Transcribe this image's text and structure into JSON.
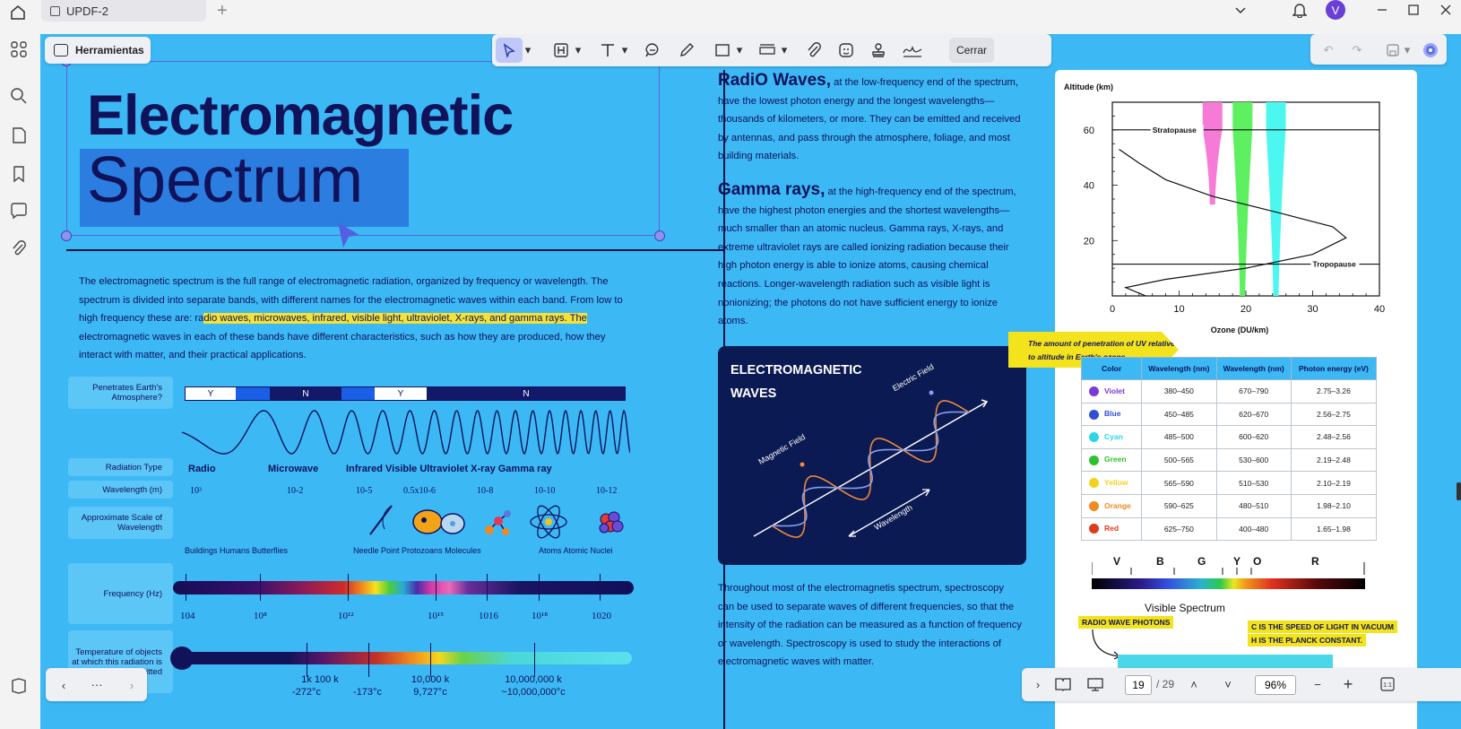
{
  "app": {
    "tab_title": "UPDF-2",
    "avatar_initial": "V"
  },
  "toolbar": {
    "tools_label": "Herramientas",
    "close_label": "Cerrar"
  },
  "left_page": {
    "title_line1": "Electromagnetic",
    "title_line2": "Spectrum",
    "intro_before": "The electromagnetic spectrum is the full range of electromagnetic radiation, organized by frequency or wavelength. The spectrum is divided into separate bands, with different names for the electromagnetic waves within each band. From low to high frequency these are: ra",
    "intro_highlight": "dio waves, microwaves, infrared, visible light, ultraviolet, X-rays, and gamma rays. The",
    "intro_after": " electromagnetic waves in each of these bands have different characteristics, such as how they are produced, how they interact with matter, and their practical applications.",
    "labels": {
      "atmosphere": "Penetrates Earth's Atmosphere?",
      "radiation_type": "Radiation Type",
      "wavelength": "Wavelength (m)",
      "scale": "Approximate Scale of Wavelength",
      "frequency": "Frequency (Hz)",
      "temperature": "Temperature of objects at which this radiation is the most intense emitted"
    },
    "atmosphere_segments": [
      "Y",
      "N",
      "Y",
      "N"
    ],
    "radiation_types": [
      "Radio",
      "Microwave",
      "Infrared Visible Ultraviolet X-ray Gamma ray"
    ],
    "wavelengths": [
      "10³",
      "10-2",
      "10-5",
      "0.5x10-6",
      "10-8",
      "10-10",
      "10-12"
    ],
    "scale_captions": [
      "Buildings Humans Butterflies",
      "Needle Point Protozoans Molecules",
      "Atoms Atomic Nuclei"
    ],
    "frequencies": [
      "104",
      "10⁸",
      "10¹²",
      "10¹⁵",
      "1016",
      "10¹⁸",
      "1020"
    ],
    "temperatures": [
      {
        "k": "1k 100 k",
        "c": "-272°c"
      },
      {
        "k": "",
        "c": "-173°c"
      },
      {
        "k": "10,000 k",
        "c": "9,727°c"
      },
      {
        "k": "10,000,000 k",
        "c": "~10,000,000°c"
      }
    ]
  },
  "mid_column": {
    "radio_lead": "RadiO Waves,",
    "radio_text": " at the low-frequency end of the spectrum, have the lowest photon energy and the longest wavelengths—thousands of kilometers, or more. They can be emitted and received by antennas, and pass through the atmosphere, foliage, and most building materials.",
    "gamma_lead": "Gamma rays,",
    "gamma_text": " at the high-frequency end of the spectrum, have the highest photon energies and the shortest wavelengths—much smaller than an atomic nucleus. Gamma rays, X-rays, and extreme ultraviolet rays are called ionizing radiation because their high photon energy is able to ionize atoms, causing chemical reactions. Longer-wavelength radiation such as visible light is nonionizing; the photons do not have sufficient energy to ionize atoms.",
    "card_title": "ELECTROMAGNETIC WAVES",
    "card_electric": "Electric Field",
    "card_magnetic": "Magnetic Field",
    "card_wavelength": "Wavelength",
    "spectro_text": "Throughout most of the electromagnetis spectrum, spectroscopy can be used to separate waves of different frequencies, so that the intensity of the radiation can be measured as a function of frequency or wavelength. Spectroscopy is used to study the interactions of electromagnetic waves with matter."
  },
  "right_column": {
    "callout": "The amount of penetration of UV relative to altitude in Earth's ozone",
    "table_headers": [
      "Color",
      "Wavelength (nm)",
      "Wavelength (nm)",
      "Photon energy (eV)"
    ],
    "table_rows": [
      {
        "color": "Violet",
        "hex": "#7a3ad8",
        "w1": "380–450",
        "w2": "670–790",
        "e": "2.75–3.26"
      },
      {
        "color": "Blue",
        "hex": "#2f4fd6",
        "w1": "450–485",
        "w2": "620–670",
        "e": "2.56–2.75"
      },
      {
        "color": "Cyan",
        "hex": "#2ad7e6",
        "w1": "485–500",
        "w2": "600–620",
        "e": "2.48–2.56"
      },
      {
        "color": "Green",
        "hex": "#2ec02e",
        "w1": "500–565",
        "w2": "530–600",
        "e": "2.19–2.48"
      },
      {
        "color": "Yellow",
        "hex": "#f2d41e",
        "w1": "565–590",
        "w2": "510–530",
        "e": "2.10–2.19"
      },
      {
        "color": "Orange",
        "hex": "#f08a1e",
        "w1": "590–625",
        "w2": "480–510",
        "e": "1.98–2.10"
      },
      {
        "color": "Red",
        "hex": "#e03a1e",
        "w1": "625–750",
        "w2": "400–480",
        "e": "1.65–1.98"
      }
    ],
    "spectrum_letters": [
      "V",
      "B",
      "G",
      "Y",
      "O",
      "R"
    ],
    "spectrum_caption": "Visible Spectrum",
    "note_radio": "RADIO WAVE PHOTONS",
    "note_c": "C IS THE SPEED OF LIGHT IN VACUUM",
    "note_h": "H IS THE PLANCK CONSTANT."
  },
  "chart_data": {
    "type": "line",
    "xlabel": "Ozone (DU/km)",
    "ylabel": "Altitude (km)",
    "xlim": [
      0,
      40
    ],
    "ylim": [
      0,
      70
    ],
    "xticks": [
      0,
      10,
      20,
      30,
      40
    ],
    "yticks": [
      20,
      40,
      60
    ],
    "series": [
      {
        "x": [
          5,
          2,
          8,
          20,
          30,
          35,
          33,
          25,
          15,
          8,
          4,
          1
        ],
        "y": [
          0,
          3,
          6,
          10,
          15,
          21,
          25,
          30,
          36,
          42,
          48,
          53
        ]
      }
    ],
    "hlines": [
      {
        "y": 60,
        "label": "Stratopause"
      },
      {
        "y": 11.5,
        "label": "Tropopause"
      }
    ],
    "bands": [
      {
        "x": 15,
        "ymin": 33,
        "color": "#f57bd6"
      },
      {
        "x": 19.5,
        "ymin": 0,
        "color": "#5ef061"
      },
      {
        "x": 24.5,
        "ymin": 0,
        "color": "#4cf7f0"
      }
    ]
  },
  "bottom": {
    "page_current": "19",
    "page_total": "/ 29",
    "zoom": "96%",
    "more": "···"
  }
}
